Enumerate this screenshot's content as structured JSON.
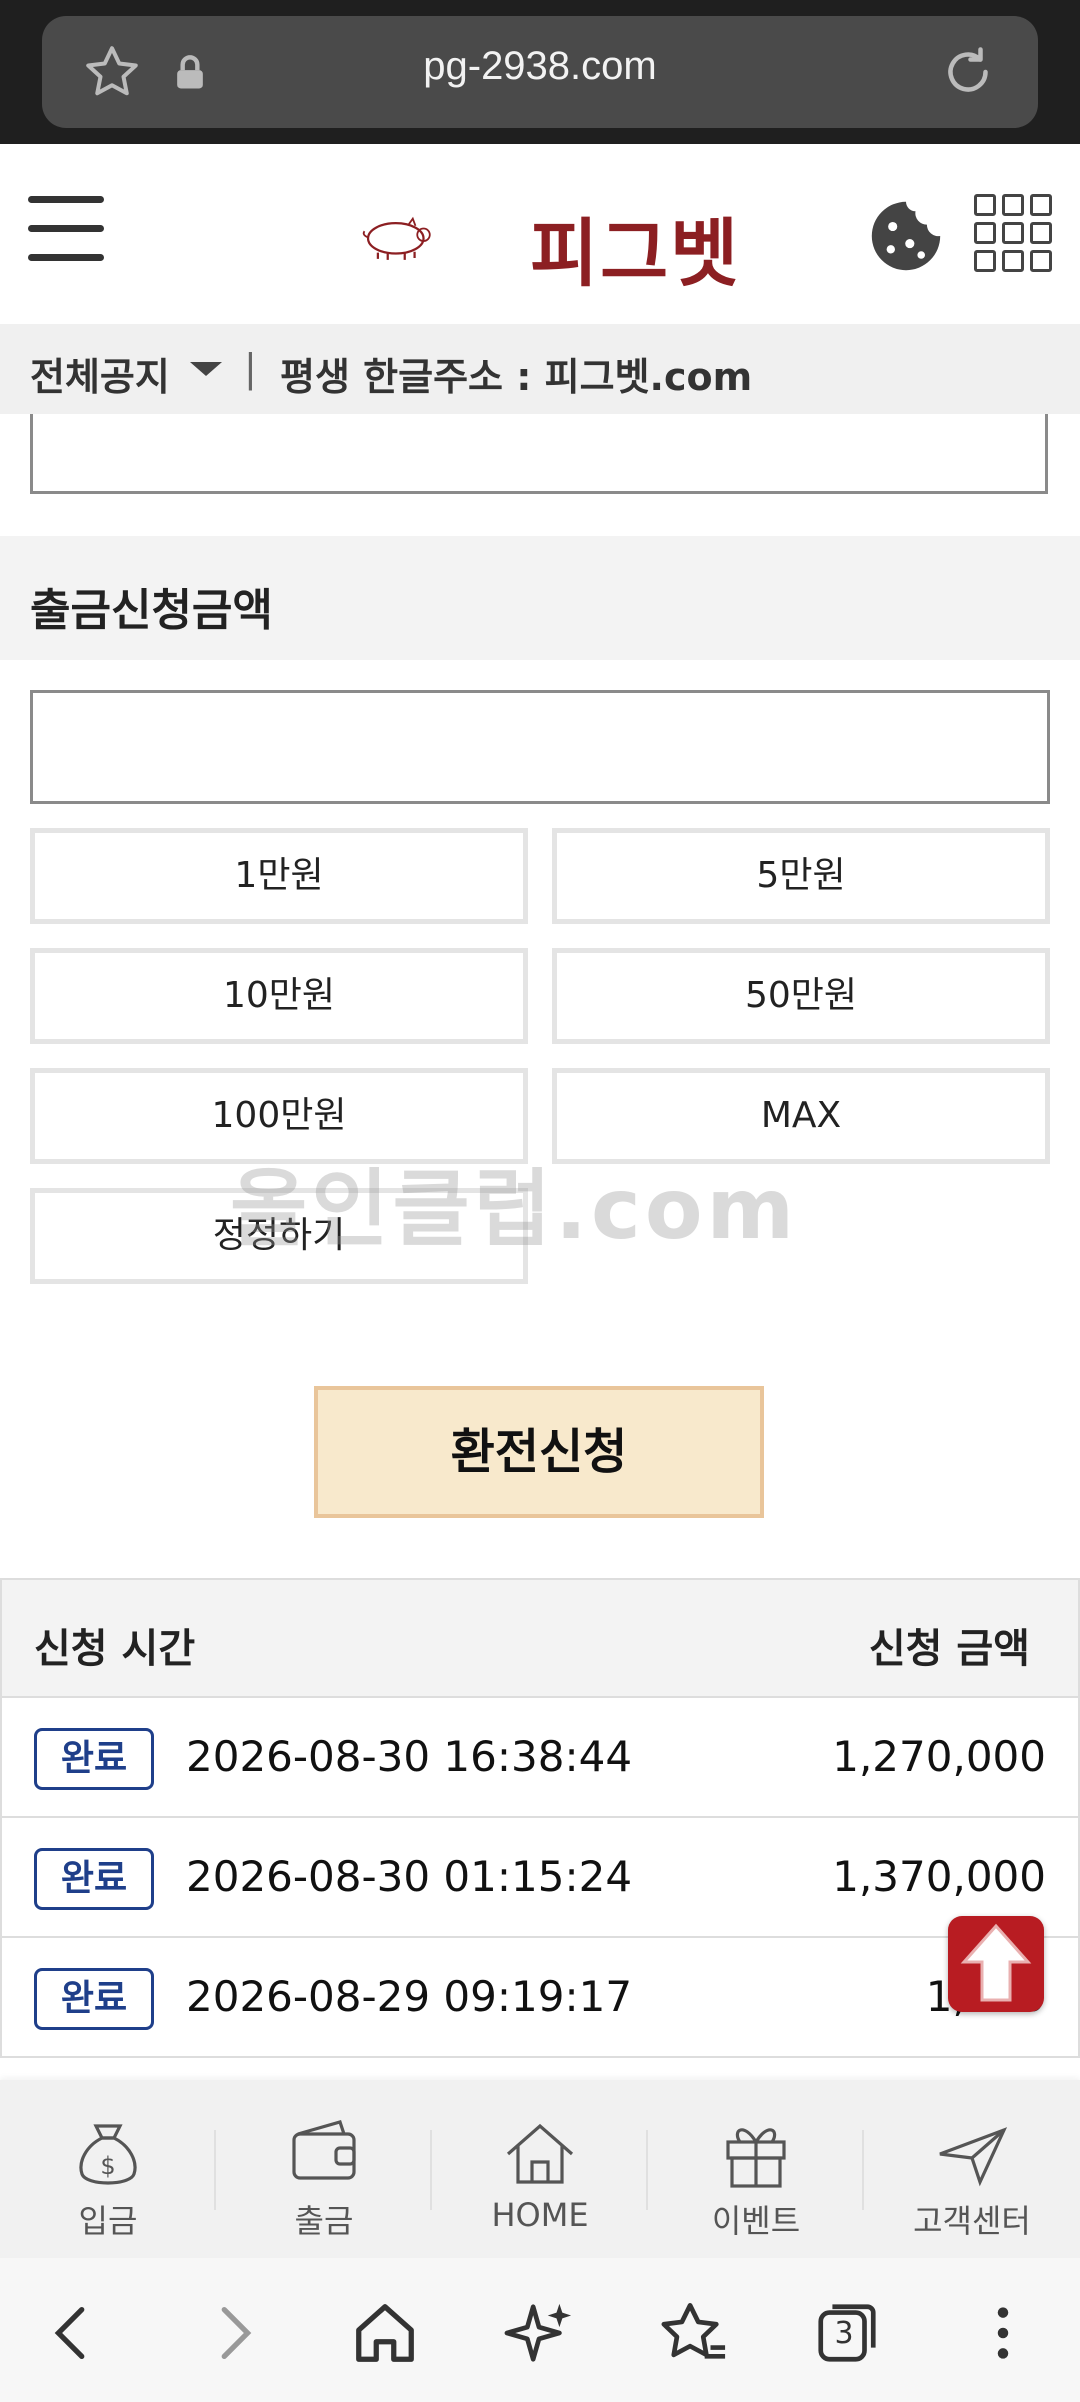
{
  "browser": {
    "url": "pg-2938.com",
    "icons": [
      "star-icon",
      "lock-icon",
      "reload-icon"
    ]
  },
  "header": {
    "logo_text": "피그벳",
    "icons": [
      "menu-icon",
      "cookie-icon",
      "grid-menu-icon"
    ],
    "brand_color": "#8c1f22"
  },
  "notice": {
    "category": "전체공지",
    "separator": "|",
    "message": "평생 한글주소 : 피그벳.com"
  },
  "withdraw": {
    "section_label": "출금신청금액",
    "amount_value": "",
    "quick_buttons": [
      "1만원",
      "5만원",
      "10만원",
      "50만원",
      "100만원",
      "MAX",
      "정정하기"
    ],
    "submit_label": "환전신청"
  },
  "watermark": "올인클럽.com",
  "history": {
    "columns": [
      "신청 시간",
      "신청 금액"
    ],
    "rows": [
      {
        "status": "완료",
        "time": "2026-08-30 16:38:44",
        "amount": "1,270,000"
      },
      {
        "status": "완료",
        "time": "2026-08-30 01:15:24",
        "amount": "1,370,000"
      },
      {
        "status": "완료",
        "time": "2026-08-29 09:19:17",
        "amount": "1,260"
      }
    ]
  },
  "bottom_nav": {
    "items": [
      {
        "label": "입금",
        "icon": "money-bag-icon"
      },
      {
        "label": "출금",
        "icon": "wallet-icon"
      },
      {
        "label": "HOME",
        "icon": "home-icon"
      },
      {
        "label": "이벤트",
        "icon": "gift-icon"
      },
      {
        "label": "고객센터",
        "icon": "paper-plane-icon"
      }
    ]
  },
  "browser_toolbar": {
    "tab_count": "3",
    "icons": [
      "back-icon",
      "forward-icon",
      "home-icon",
      "sparkle-icon",
      "bookmarks-icon",
      "tabs-icon",
      "more-icon"
    ]
  }
}
